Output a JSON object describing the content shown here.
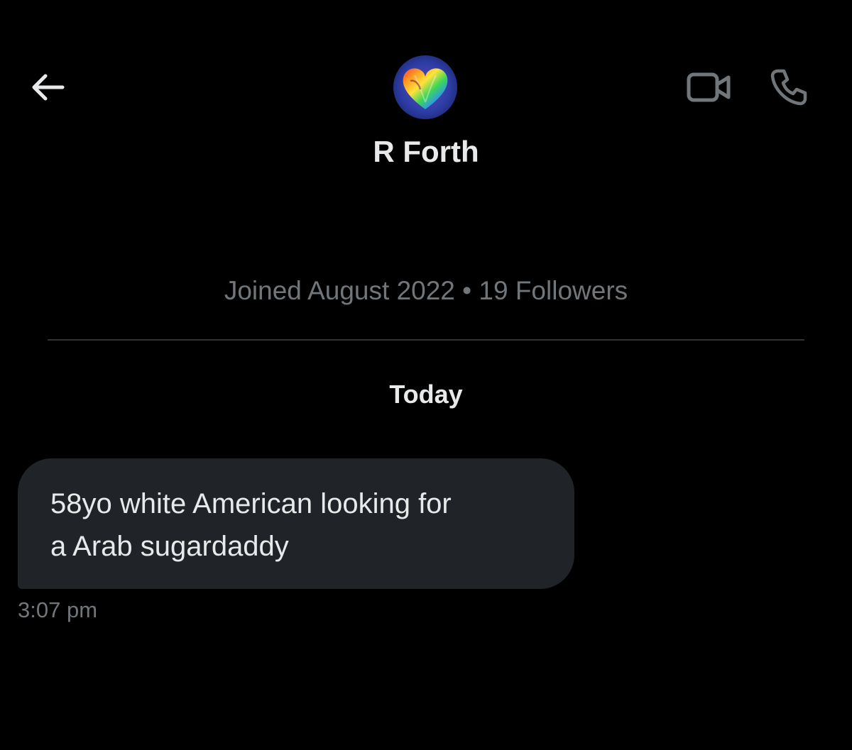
{
  "header": {
    "back_icon": "arrow-left-icon",
    "video_call_icon": "video-camera-icon",
    "voice_call_icon": "phone-icon",
    "display_name": "R Forth",
    "avatar_icon": "rainbow-heart-avatar"
  },
  "profile": {
    "meta": "Joined August 2022 • 19 Followers"
  },
  "conversation": {
    "date_separator": "Today",
    "messages": [
      {
        "text_line_1": "58yo white American looking for",
        "text_line_2": "a Arab sugardaddy",
        "time": "3:07 pm"
      }
    ]
  },
  "colors": {
    "background": "#000000",
    "primary_text": "#e7e9ea",
    "secondary_text": "#71767b",
    "bubble": "#202327",
    "divider": "#2f3336"
  }
}
